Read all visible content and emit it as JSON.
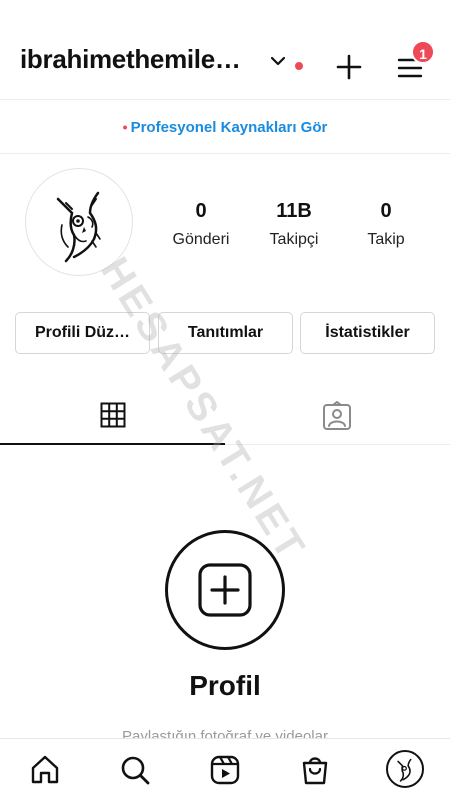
{
  "header": {
    "username": "ibrahimethemile…",
    "notification_count": "1",
    "icons": [
      "chevron-down-icon",
      "plus-icon",
      "menu-icon"
    ],
    "accent": "#ed4956"
  },
  "pro_bar": {
    "label": "Profesyonel Kaynakları Gör",
    "color": "#1a8ce0"
  },
  "stats": [
    {
      "value": "0",
      "label": "Gönderi"
    },
    {
      "value": "11B",
      "label": "Takipçi"
    },
    {
      "value": "0",
      "label": "Takip"
    }
  ],
  "actions": {
    "edit_profile": "Profili Düz…",
    "promotions": "Tanıtımlar",
    "insights": "İstatistikler"
  },
  "tabs": [
    "grid-icon",
    "tagged-icon"
  ],
  "empty_state": {
    "title": "Profil",
    "subtitle": "Paylaştığın fotoğraf ve videolar"
  },
  "watermark": "HESAPSAT.NET",
  "bottom_nav": [
    "home-icon",
    "search-icon",
    "reels-icon",
    "shop-icon",
    "profile-avatar"
  ]
}
